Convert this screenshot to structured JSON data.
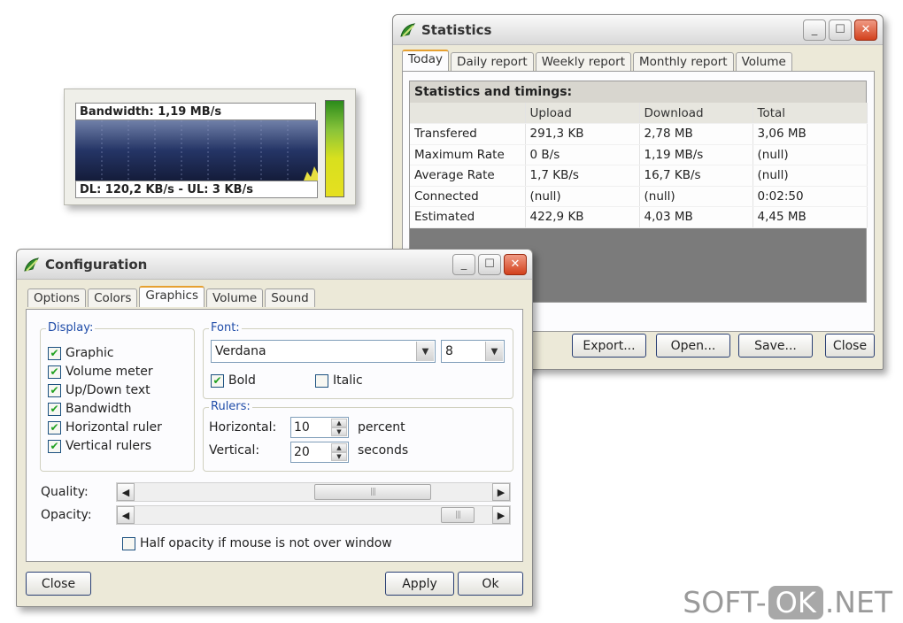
{
  "meter": {
    "bandwidth": "Bandwidth: 1,19 MB/s",
    "dl_ul": "DL: 120,2 KB/s - UL: 3 KB/s"
  },
  "stats": {
    "title": "Statistics",
    "tabs": [
      "Today",
      "Daily report",
      "Weekly report",
      "Monthly report",
      "Volume"
    ],
    "section": "Statistics and timings:",
    "columns": [
      "",
      "Upload",
      "Download",
      "Total"
    ],
    "rows": [
      [
        "Transfered",
        "291,3 KB",
        "2,78 MB",
        "3,06 MB"
      ],
      [
        "Maximum Rate",
        "0 B/s",
        "1,19 MB/s",
        "(null)"
      ],
      [
        "Average Rate",
        "1,7 KB/s",
        "16,7 KB/s",
        "(null)"
      ],
      [
        "Connected",
        "(null)",
        "(null)",
        "0:02:50"
      ],
      [
        "Estimated",
        "422,9 KB",
        "4,03 MB",
        "4,45 MB"
      ]
    ],
    "buttons": {
      "export": "Export...",
      "open": "Open...",
      "save": "Save...",
      "close": "Close"
    }
  },
  "config": {
    "title": "Configuration",
    "tabs": [
      "Options",
      "Colors",
      "Graphics",
      "Volume",
      "Sound"
    ],
    "display_label": "Display:",
    "display_items": [
      {
        "label": "Graphic",
        "checked": true
      },
      {
        "label": "Volume meter",
        "checked": true
      },
      {
        "label": "Up/Down text",
        "checked": true
      },
      {
        "label": "Bandwidth",
        "checked": true
      },
      {
        "label": "Horizontal ruler",
        "checked": true
      },
      {
        "label": "Vertical rulers",
        "checked": true
      }
    ],
    "font_label": "Font:",
    "font_name": "Verdana",
    "font_size": "8",
    "bold_label": "Bold",
    "bold_checked": true,
    "italic_label": "Italic",
    "italic_checked": false,
    "rulers_label": "Rulers:",
    "horizontal_label": "Horizontal:",
    "horizontal_value": "10",
    "horizontal_unit": "percent",
    "vertical_label": "Vertical:",
    "vertical_value": "20",
    "vertical_unit": "seconds",
    "quality_label": "Quality:",
    "quality_level": 0.75,
    "opacity_label": "Opacity:",
    "opacity_level": 0.95,
    "half_opacity_label": "Half opacity if mouse is not over window",
    "buttons": {
      "close": "Close",
      "apply": "Apply",
      "ok": "Ok"
    }
  },
  "watermark": {
    "left": "SOFT-",
    "mid": "OK",
    "right": ".NET"
  },
  "colors": {
    "tab_highlight": "#e6a030",
    "close_red": "#d2411d",
    "check_green": "#21a121",
    "meter_bg": "#1c2a52"
  }
}
